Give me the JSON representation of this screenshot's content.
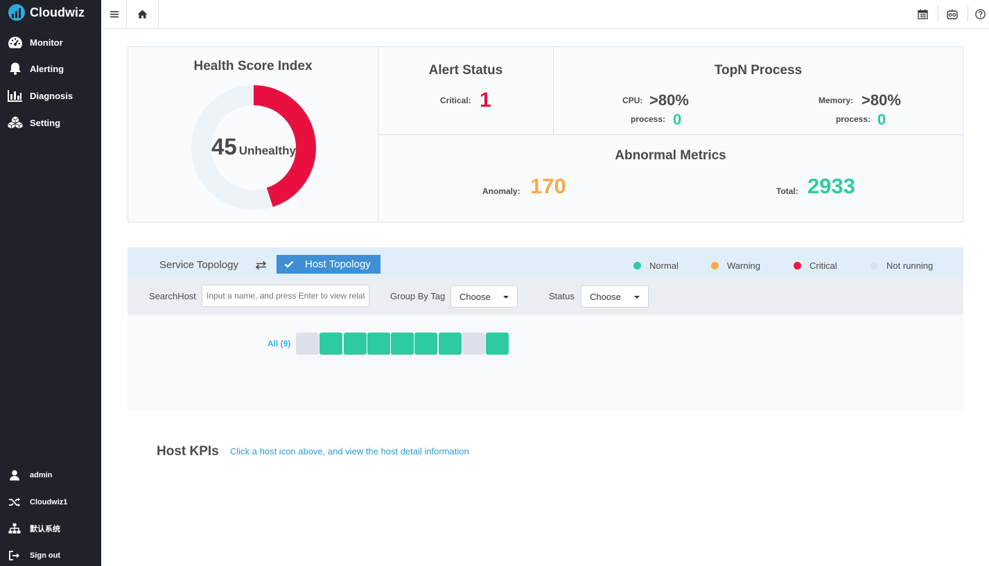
{
  "app": {
    "name": "Cloudwiz"
  },
  "sidebar": {
    "items": [
      {
        "label": "Monitor",
        "icon": "dashboard-icon"
      },
      {
        "label": "Alerting",
        "icon": "bell-icon"
      },
      {
        "label": "Diagnosis",
        "icon": "bar-chart-icon"
      },
      {
        "label": "Setting",
        "icon": "cubes-icon"
      }
    ],
    "bottom": [
      {
        "label": "admin",
        "icon": "user-icon"
      },
      {
        "label": "Cloudwiz1",
        "icon": "shuffle-icon"
      },
      {
        "label": "默认系统",
        "icon": "sitemap-icon"
      },
      {
        "label": "Sign out",
        "icon": "sign-out-icon"
      }
    ]
  },
  "topbar": {
    "icons": [
      "menu-icon",
      "home-icon",
      "calendar-icon",
      "robot-icon",
      "help-icon"
    ]
  },
  "health": {
    "title": "Health Score Index",
    "score": "45",
    "status": "Unhealthy",
    "score_fraction": 0.45
  },
  "alert": {
    "title": "Alert Status",
    "critical_label": "Critical:",
    "critical_value": "1"
  },
  "topn": {
    "title": "TopN Process",
    "cpu_label": "CPU:",
    "cpu_value": ">80%",
    "cpu_process_label": "process:",
    "cpu_process_value": "0",
    "mem_label": "Memory:",
    "mem_value": ">80%",
    "mem_process_label": "process:",
    "mem_process_value": "0"
  },
  "abnormal": {
    "title": "Abnormal Metrics",
    "anomaly_label": "Anomaly:",
    "anomaly_value": "170",
    "total_label": "Total:",
    "total_value": "2933"
  },
  "topology": {
    "service_tab": "Service Topology",
    "host_tab": "Host Topology",
    "legend": [
      {
        "label": "Normal",
        "color": "#2ecba3"
      },
      {
        "label": "Warning",
        "color": "#f9a94b"
      },
      {
        "label": "Critical",
        "color": "#e8183f"
      },
      {
        "label": "Not running",
        "color": "#dde2ea"
      }
    ],
    "search_label": "SearchHost",
    "search_placeholder": "Input a name, and press Enter to view related host",
    "group_label": "Group By Tag",
    "group_value": "Choose",
    "status_label": "Status",
    "status_value": "Choose",
    "all_label": "All (9)",
    "hosts": [
      "Not running",
      "Normal",
      "Normal",
      "Normal",
      "Normal",
      "Normal",
      "Normal",
      "Not running",
      "Normal"
    ]
  },
  "kpis": {
    "title": "Host KPIs",
    "hint": "Click a host icon above, and view the host detail information"
  },
  "colors": {
    "sidebar": "#1f2228",
    "accent": "#3e8fd6",
    "normal": "#2ecba3",
    "warning": "#f9a94b",
    "critical": "#e8183f",
    "idle": "#dde2ea"
  }
}
